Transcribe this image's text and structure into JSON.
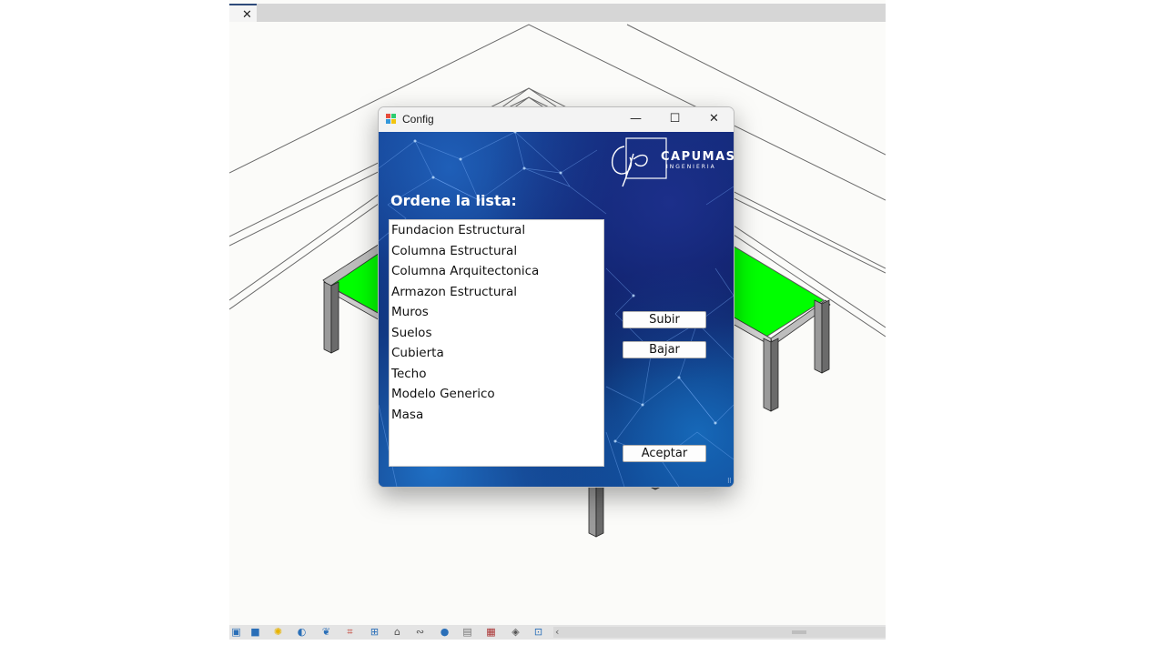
{
  "viewport": {
    "tab_close_glyph": "✕",
    "slab_color": "#00ff00"
  },
  "bottom_toolbar": {
    "icons": [
      "scale-icon",
      "visual-style-icon",
      "sun-path-icon",
      "shadows-icon",
      "render-icon",
      "crop-view-icon",
      "show-crop-icon",
      "unlock-3d-view-icon",
      "temporary-hide-icon",
      "reveal-hidden-icon",
      "worksharing-icon",
      "design-options-icon",
      "analysis-model-icon",
      "highlight-displacement-icon",
      "constraints-icon"
    ],
    "scroll_left_glyph": "‹"
  },
  "window": {
    "title": "Config",
    "minimize_glyph": "—",
    "maximize_glyph": "☐",
    "close_glyph": "✕",
    "brand": {
      "name": "CAPUMAS",
      "subtitle": "INGENIERIA"
    },
    "heading": "Ordene la lista:",
    "list_items": [
      "Fundacion Estructural",
      "Columna Estructural",
      "Columna Arquitectonica",
      "Armazon Estructural",
      "Muros",
      "Suelos",
      "Cubierta",
      "Techo",
      "Modelo Generico",
      "Masa"
    ],
    "buttons": {
      "up": "Subir",
      "down": "Bajar",
      "accept": "Aceptar"
    },
    "colors": {
      "background_dark": "#0a1550",
      "background_accent": "#1f6fc4"
    }
  }
}
